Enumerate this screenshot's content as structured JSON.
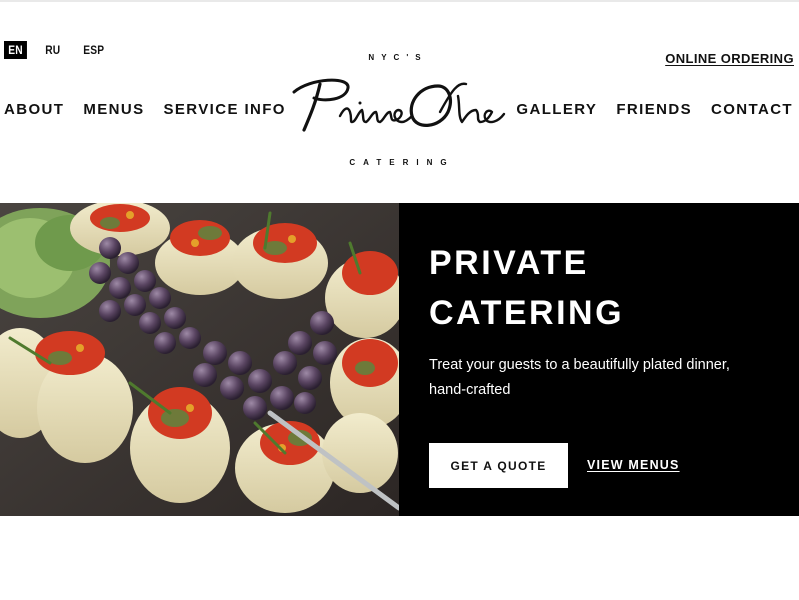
{
  "languages": [
    {
      "label": "EN",
      "active": true
    },
    {
      "label": "RU",
      "active": false
    },
    {
      "label": "ESP",
      "active": false
    }
  ],
  "header": {
    "online_ordering": "ONLINE ORDERING",
    "logo": {
      "kicker": "NYC'S",
      "wordmark": "PrimeOne",
      "sub": "CATERING"
    }
  },
  "nav": {
    "left": [
      "ABOUT",
      "MENUS",
      "SERVICE INFO"
    ],
    "right": [
      "GALLERY",
      "FRIENDS",
      "CONTACT"
    ]
  },
  "hero": {
    "title_line1": "PRIVATE",
    "title_line2": "CATERING",
    "text": "Treat your guests to a beautifully plated dinner, hand-crafted",
    "primary_button": "GET A QUOTE",
    "secondary_link": "VIEW MENUS",
    "image_alt": "catering-food-photo"
  },
  "colors": {
    "panel_bg": "#000000",
    "text": "#111111",
    "background": "#ffffff"
  }
}
